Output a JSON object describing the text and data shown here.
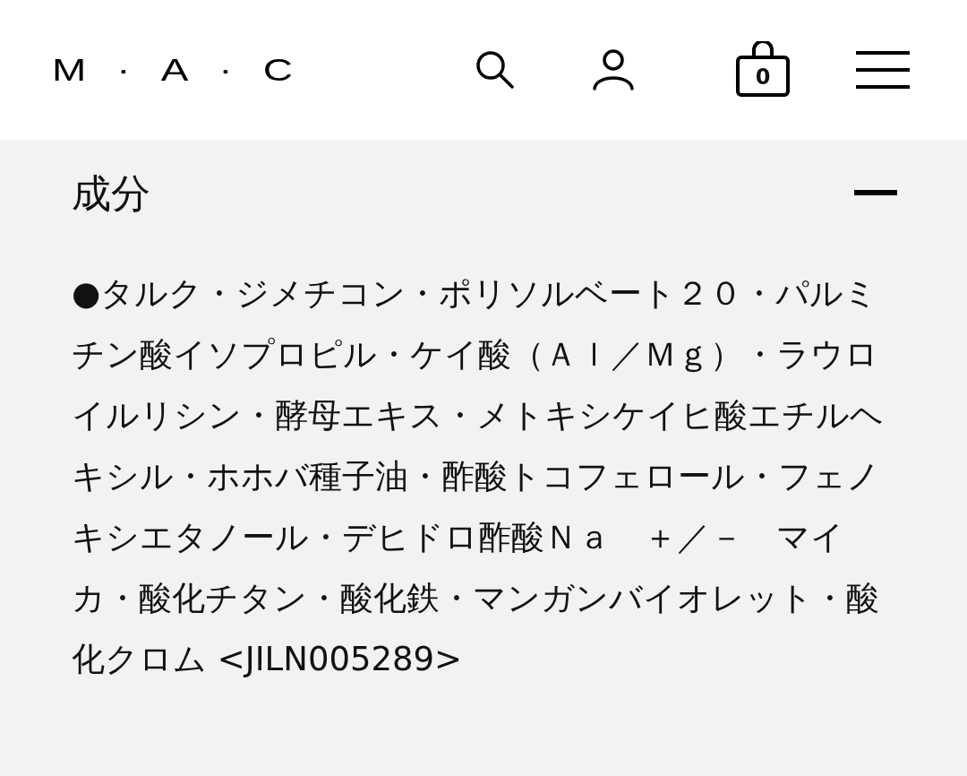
{
  "header": {
    "logo": "M·A·C",
    "bag_count": "0"
  },
  "section": {
    "title": "成分",
    "expanded": true,
    "text": "●タルク・ジメチコン・ポリソルベート２０・パルミチン酸イソプロピル・ケイ酸（Ａｌ／Ｍｇ）・ラウロイルリシン・酵母エキス・メトキシケイヒ酸エチルヘキシル・ホホバ種子油・酢酸トコフェロール・フェノキシエタノール・デヒドロ酢酸Ｎａ　＋／－　マイカ・酸化チタン・酸化鉄・マンガンバイオレット・酸化クロム <JILN005289>"
  }
}
